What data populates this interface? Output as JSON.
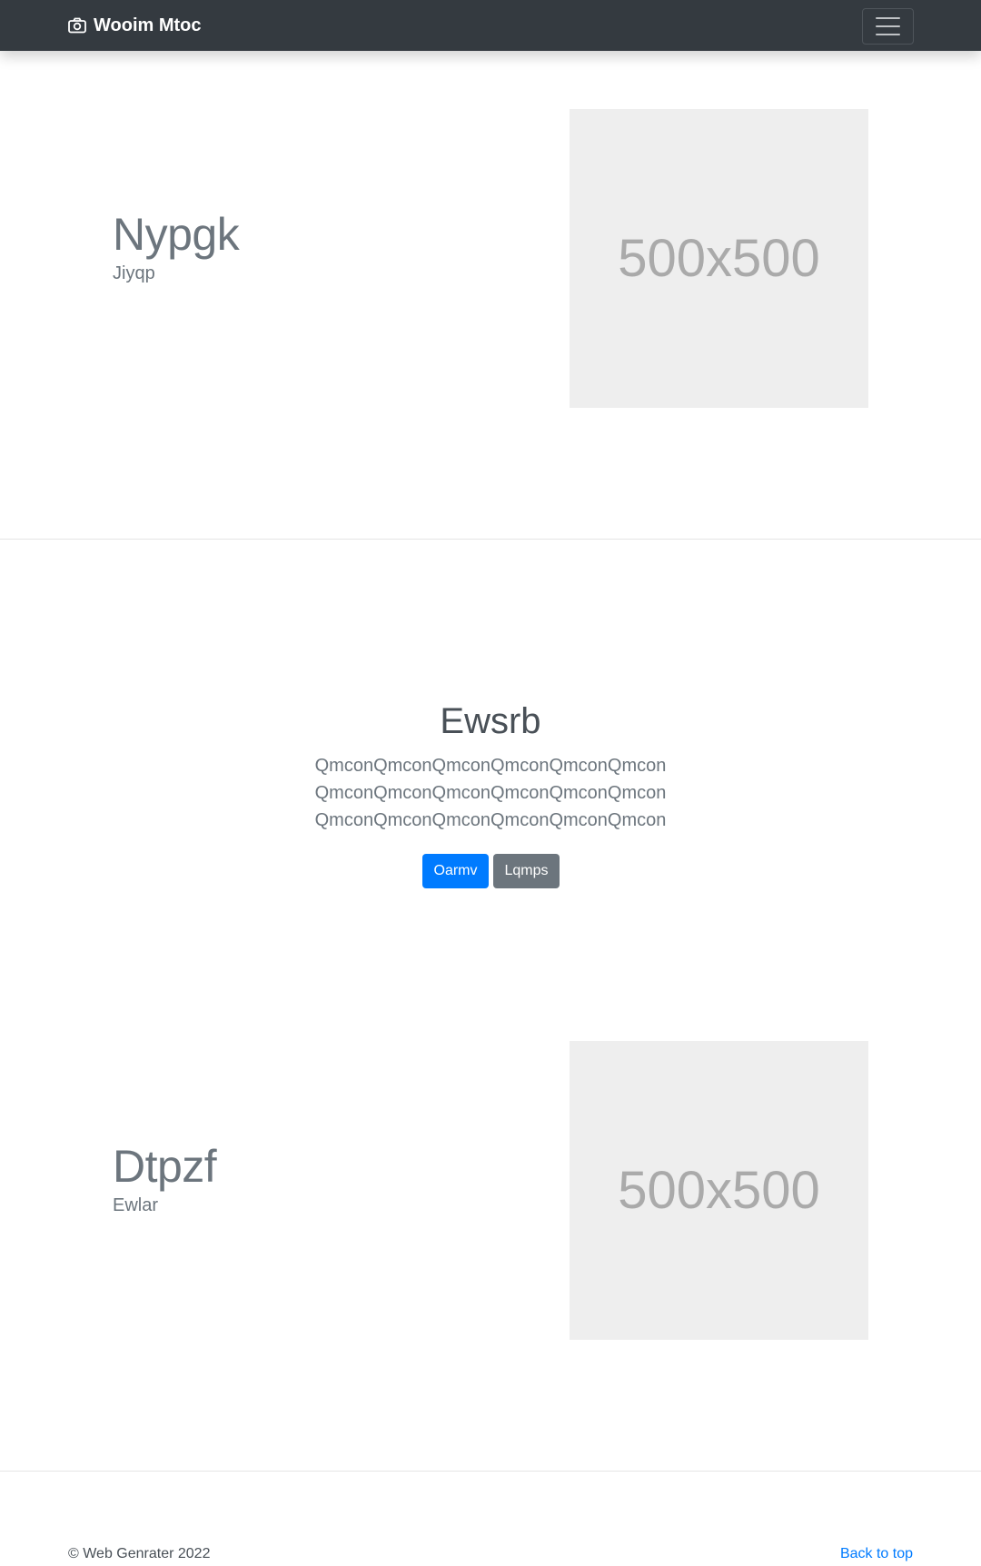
{
  "navbar": {
    "brand": "Wooim Mtoc",
    "brand_icon": "camera-icon",
    "toggler_icon": "hamburger-menu-icon",
    "background": "#343a40"
  },
  "feature1": {
    "heading": "Nypgk",
    "subheading": "Jiyqp",
    "image_label": "500x500"
  },
  "center": {
    "heading": "Ewsrb",
    "lead_lines": [
      "QmconQmconQmconQmconQmconQmcon",
      "QmconQmconQmconQmconQmconQmcon",
      "QmconQmconQmconQmconQmconQmcon"
    ],
    "primary_button": "Oarmv",
    "secondary_button": "Lqmps",
    "primary_color": "#007bff",
    "secondary_color": "#6c757d"
  },
  "feature2": {
    "heading": "Dtpzf",
    "subheading": "Ewlar",
    "image_label": "500x500"
  },
  "footer": {
    "copyright": "© Web Genrater 2022",
    "back_to_top": "Back to top"
  }
}
